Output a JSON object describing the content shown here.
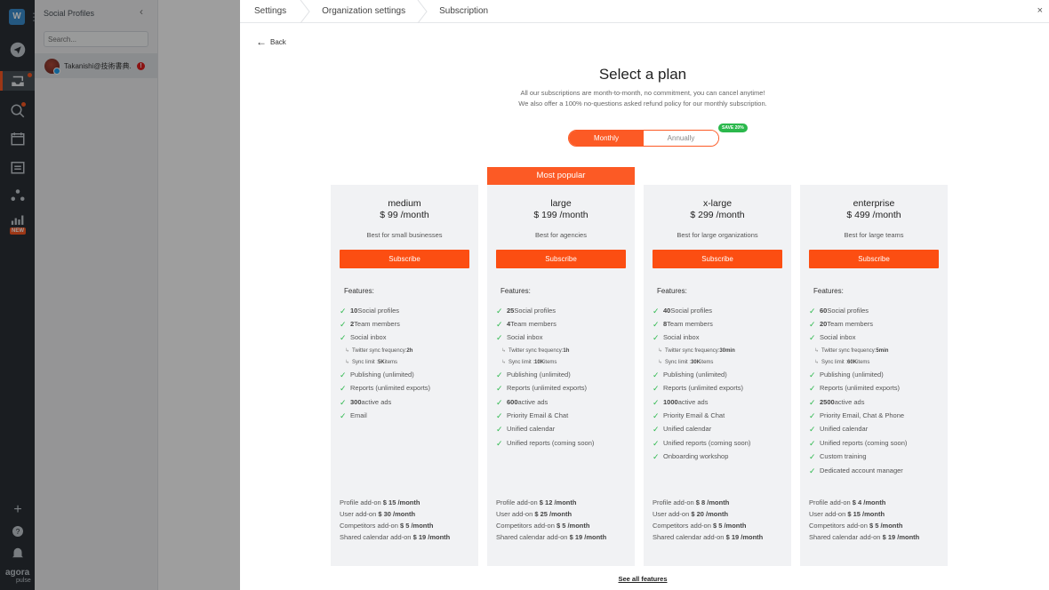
{
  "workspace_initial": "W",
  "panel": {
    "title": "Social Profiles",
    "search_placeholder": "Search...",
    "profile_name": "Takanishi@技術書典..."
  },
  "logo": {
    "main": "agora",
    "sub": "pulse"
  },
  "new_badge": "NEW",
  "breadcrumbs": [
    "Settings",
    "Organization settings",
    "Subscription"
  ],
  "back_label": "Back",
  "title": "Select a plan",
  "subtitle1": "All our subscriptions are month-to-month, no commitment, you can cancel anytime!",
  "subtitle2": "We also offer a 100% no-questions asked refund policy for our monthly subscription.",
  "billing": {
    "monthly": "Monthly",
    "annually": "Annually",
    "save_badge": "SAVE 20%",
    "selected": "Monthly"
  },
  "most_popular": "Most popular",
  "features_label": "Features:",
  "subscribe_label": "Subscribe",
  "see_all": "See all features",
  "plans": [
    {
      "name": "medium",
      "price": "$ 99 /month",
      "best": "Best for small businesses",
      "features": [
        {
          "n": "10",
          "t": " Social profiles"
        },
        {
          "n": "2",
          "t": " Team members"
        },
        {
          "n": "",
          "t": "Social inbox"
        },
        {
          "sub": true,
          "t": "Twitter sync frequency: ",
          "n": "2h"
        },
        {
          "sub": true,
          "t": "Sync limit : ",
          "n": "5K",
          "t2": " items"
        },
        {
          "n": "",
          "t": "Publishing (unlimited)"
        },
        {
          "n": "",
          "t": "Reports (unlimited exports)"
        },
        {
          "n": "300",
          "t": " active ads"
        },
        {
          "n": "",
          "t": "Email"
        }
      ],
      "addons": [
        {
          "t": "Profile add-on ",
          "v": "$ 15 /month"
        },
        {
          "t": "User add-on ",
          "v": "$ 30 /month"
        },
        {
          "t": "Competitors add-on ",
          "v": "$ 5 /month"
        },
        {
          "t": "Shared calendar add-on ",
          "v": "$ 19 /month"
        }
      ]
    },
    {
      "name": "large",
      "price": "$ 199 /month",
      "best": "Best for agencies",
      "features": [
        {
          "n": "25",
          "t": " Social profiles"
        },
        {
          "n": "4",
          "t": " Team members"
        },
        {
          "n": "",
          "t": "Social inbox"
        },
        {
          "sub": true,
          "t": "Twitter sync frequency: ",
          "n": "1h"
        },
        {
          "sub": true,
          "t": "Sync limit : ",
          "n": "10K",
          "t2": " items"
        },
        {
          "n": "",
          "t": "Publishing (unlimited)"
        },
        {
          "n": "",
          "t": "Reports (unlimited exports)"
        },
        {
          "n": "600",
          "t": " active ads"
        },
        {
          "n": "",
          "t": "Priority Email & Chat"
        },
        {
          "n": "",
          "t": "Unified calendar"
        },
        {
          "n": "",
          "t": "Unified reports (coming soon)"
        }
      ],
      "addons": [
        {
          "t": "Profile add-on ",
          "v": "$ 12 /month"
        },
        {
          "t": "User add-on ",
          "v": "$ 25 /month"
        },
        {
          "t": "Competitors add-on ",
          "v": "$ 5 /month"
        },
        {
          "t": "Shared calendar add-on ",
          "v": "$ 19 /month"
        }
      ]
    },
    {
      "name": "x-large",
      "price": "$ 299 /month",
      "best": "Best for large organizations",
      "features": [
        {
          "n": "40",
          "t": " Social profiles"
        },
        {
          "n": "8",
          "t": " Team members"
        },
        {
          "n": "",
          "t": "Social inbox"
        },
        {
          "sub": true,
          "t": "Twitter sync frequency: ",
          "n": "30min"
        },
        {
          "sub": true,
          "t": "Sync limit : ",
          "n": "30K",
          "t2": " items"
        },
        {
          "n": "",
          "t": "Publishing (unlimited)"
        },
        {
          "n": "",
          "t": "Reports (unlimited exports)"
        },
        {
          "n": "1000",
          "t": " active ads"
        },
        {
          "n": "",
          "t": "Priority Email & Chat"
        },
        {
          "n": "",
          "t": "Unified calendar"
        },
        {
          "n": "",
          "t": "Unified reports (coming soon)"
        },
        {
          "n": "",
          "t": "Onboarding workshop"
        }
      ],
      "addons": [
        {
          "t": "Profile add-on ",
          "v": "$ 8 /month"
        },
        {
          "t": "User add-on ",
          "v": "$ 20 /month"
        },
        {
          "t": "Competitors add-on ",
          "v": "$ 5 /month"
        },
        {
          "t": "Shared calendar add-on ",
          "v": "$ 19 /month"
        }
      ]
    },
    {
      "name": "enterprise",
      "price": "$ 499 /month",
      "best": "Best for large teams",
      "features": [
        {
          "n": "60",
          "t": " Social profiles"
        },
        {
          "n": "20",
          "t": " Team members"
        },
        {
          "n": "",
          "t": "Social inbox"
        },
        {
          "sub": true,
          "t": "Twitter sync frequency: ",
          "n": "5min"
        },
        {
          "sub": true,
          "t": "Sync limit : ",
          "n": "60K",
          "t2": " items"
        },
        {
          "n": "",
          "t": "Publishing (unlimited)"
        },
        {
          "n": "",
          "t": "Reports (unlimited exports)"
        },
        {
          "n": "2500",
          "t": " active ads"
        },
        {
          "n": "",
          "t": "Priority Email, Chat & Phone"
        },
        {
          "n": "",
          "t": "Unified calendar"
        },
        {
          "n": "",
          "t": "Unified reports (coming soon)"
        },
        {
          "n": "",
          "t": "Custom training"
        },
        {
          "n": "",
          "t": "Dedicated account manager"
        }
      ],
      "addons": [
        {
          "t": "Profile add-on ",
          "v": "$ 4 /month"
        },
        {
          "t": "User add-on ",
          "v": "$ 15 /month"
        },
        {
          "t": "Competitors add-on ",
          "v": "$ 5 /month"
        },
        {
          "t": "Shared calendar add-on ",
          "v": "$ 19 /month"
        }
      ]
    }
  ]
}
